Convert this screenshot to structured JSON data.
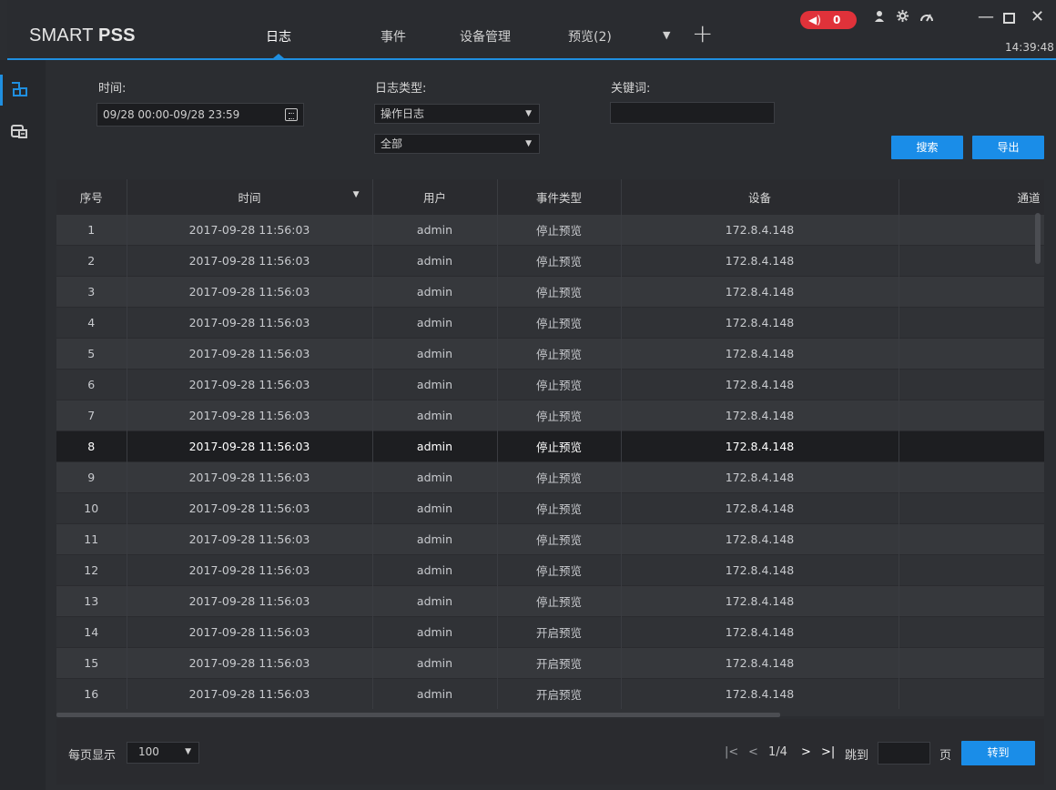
{
  "app": {
    "brand_light": "SMART ",
    "brand_bold": "PSS"
  },
  "tabs": [
    {
      "label": "日志",
      "active": true
    },
    {
      "label": "事件"
    },
    {
      "label": "设备管理"
    },
    {
      "label": "预览(2)"
    }
  ],
  "header": {
    "alarm_count": "0",
    "clock": "14:39:48"
  },
  "filters": {
    "time_label": "时间:",
    "time_value": "09/28 00:00-09/28 23:59",
    "log_type_label": "日志类型:",
    "log_type_value": "操作日志",
    "sub_type_value": "全部",
    "keyword_label": "关键词:",
    "keyword_value": "",
    "search_button": "搜索",
    "export_button": "导出"
  },
  "table": {
    "columns": [
      "序号",
      "时间",
      "用户",
      "事件类型",
      "设备",
      "通道"
    ],
    "rows": [
      [
        "1",
        "2017-09-28 11:56:03",
        "admin",
        "停止预览",
        "172.8.4.148",
        ""
      ],
      [
        "2",
        "2017-09-28 11:56:03",
        "admin",
        "停止预览",
        "172.8.4.148",
        ""
      ],
      [
        "3",
        "2017-09-28 11:56:03",
        "admin",
        "停止预览",
        "172.8.4.148",
        ""
      ],
      [
        "4",
        "2017-09-28 11:56:03",
        "admin",
        "停止预览",
        "172.8.4.148",
        ""
      ],
      [
        "5",
        "2017-09-28 11:56:03",
        "admin",
        "停止预览",
        "172.8.4.148",
        ""
      ],
      [
        "6",
        "2017-09-28 11:56:03",
        "admin",
        "停止预览",
        "172.8.4.148",
        ""
      ],
      [
        "7",
        "2017-09-28 11:56:03",
        "admin",
        "停止预览",
        "172.8.4.148",
        ""
      ],
      [
        "8",
        "2017-09-28 11:56:03",
        "admin",
        "停止预览",
        "172.8.4.148",
        ""
      ],
      [
        "9",
        "2017-09-28 11:56:03",
        "admin",
        "停止预览",
        "172.8.4.148",
        ""
      ],
      [
        "10",
        "2017-09-28 11:56:03",
        "admin",
        "停止预览",
        "172.8.4.148",
        ""
      ],
      [
        "11",
        "2017-09-28 11:56:03",
        "admin",
        "停止预览",
        "172.8.4.148",
        ""
      ],
      [
        "12",
        "2017-09-28 11:56:03",
        "admin",
        "停止预览",
        "172.8.4.148",
        ""
      ],
      [
        "13",
        "2017-09-28 11:56:03",
        "admin",
        "停止预览",
        "172.8.4.148",
        ""
      ],
      [
        "14",
        "2017-09-28 11:56:03",
        "admin",
        "开启预览",
        "172.8.4.148",
        ""
      ],
      [
        "15",
        "2017-09-28 11:56:03",
        "admin",
        "开启预览",
        "172.8.4.148",
        ""
      ],
      [
        "16",
        "2017-09-28 11:56:03",
        "admin",
        "开启预览",
        "172.8.4.148",
        ""
      ]
    ],
    "selected_row": 8
  },
  "footer": {
    "per_page_label": "每页显示",
    "per_page_value": "100",
    "page_indicator": "1/4",
    "jump_label": "跳到",
    "jump_value": "",
    "page_unit": "页",
    "goto_button": "转到"
  },
  "colors": {
    "accent": "#1a8de8",
    "alarm": "#e0323a"
  },
  "icons": [
    "device-list-icon",
    "device-tree-icon",
    "speaker-icon",
    "user-icon",
    "settings-icon",
    "performance-icon",
    "calendar-icon"
  ]
}
